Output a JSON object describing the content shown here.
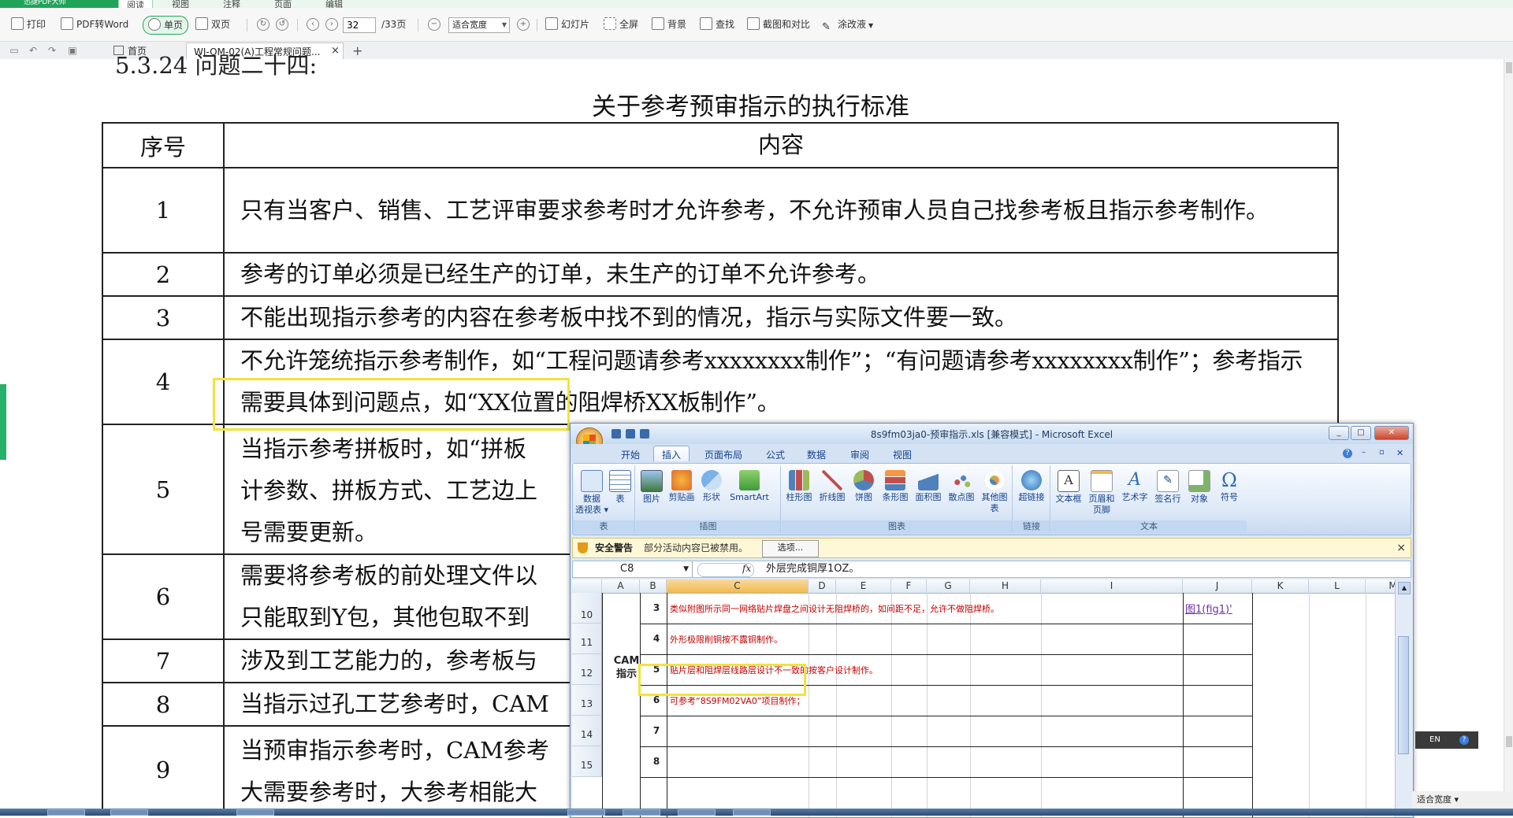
{
  "pdf_app": {
    "app_name": "迅捷PDF大师",
    "menu": [
      "阅读",
      "视图",
      "注释",
      "页面",
      "编辑"
    ],
    "toolbar": {
      "print": "打印",
      "pdf_to_word": "PDF转Word",
      "single_page": "单页",
      "double_page": "双页",
      "current_page": "32",
      "total_pages": "/33页",
      "zoom": "适合宽度",
      "slideshow": "幻灯片",
      "fullscreen": "全屏",
      "background": "背景",
      "find": "查找",
      "crop_compare": "截图和对比",
      "eraser": "涂改液"
    },
    "tabs": {
      "home": "首页",
      "document": "WI-OM-02(A)工程常规问题...",
      "close": "×",
      "add": "+"
    }
  },
  "document": {
    "section_heading": "5.3.24 问题二十四:",
    "title": "关于参考预审指示的执行标准",
    "table": {
      "headers": [
        "序号",
        "内容"
      ],
      "rows": [
        {
          "num": "1",
          "text": "只有当客户、销售、工艺评审要求参考时才允许参考，不允许预审人员自己找参考板且指示参考制作。"
        },
        {
          "num": "2",
          "text": "参考的订单必须是已经生产的订单，未生产的订单不允许参考。"
        },
        {
          "num": "3",
          "text": "不能出现指示参考的内容在参考板中找不到的情况，指示与实际文件要一致。"
        },
        {
          "num": "4",
          "text": "不允许笼统指示参考制作，如“工程问题请参考xxxxxxxx制作”；“有问题请参考xxxxxxxx制作”；参考指示需要具体到问题点，如“XX位置的阻焊桥XX板制作”。"
        },
        {
          "num": "5",
          "text": "当指示参考拼板时，如“拼板\n计参数、拼板方式、工艺边上\n号需要更新。"
        },
        {
          "num": "6",
          "text": "需要将参考板的前处理文件以\n只能取到Y包，其他包取不到"
        },
        {
          "num": "7",
          "text": "涉及到工艺能力的，参考板与"
        },
        {
          "num": "8",
          "text": "当指示过孔工艺参考时，CAM"
        },
        {
          "num": "9",
          "text": "当预审指示参考时，CAM参考\n大需要参考时，大参考相能大"
        }
      ]
    }
  },
  "excel": {
    "title": "8s9fm03ja0-预审指示.xls  [兼容模式] - Microsoft Excel",
    "tabs": [
      "开始",
      "插入",
      "页面布局",
      "公式",
      "数据",
      "审阅",
      "视图"
    ],
    "active_tab": "插入",
    "ribbon_groups": [
      {
        "label": "表",
        "buttons": [
          "数据\n透视表 ▾",
          "表"
        ]
      },
      {
        "label": "插图",
        "buttons": [
          "图片",
          "剪贴画",
          "形状",
          "SmartArt"
        ]
      },
      {
        "label": "图表",
        "buttons": [
          "柱形图",
          "折线图",
          "饼图",
          "条形图",
          "面积图",
          "散点图",
          "其他图表"
        ]
      },
      {
        "label": "链接",
        "buttons": [
          "超链接"
        ]
      },
      {
        "label": "文本",
        "buttons": [
          "文本框",
          "页眉和\n页脚",
          "艺术字",
          "签名行",
          "对象",
          "符号"
        ]
      }
    ],
    "security": {
      "title": "安全警告",
      "message": "部分活动内容已被禁用。",
      "button": "选项...",
      "close": "×"
    },
    "name_box": "C8",
    "fx": "fx",
    "formula": "外层完成铜厚1OZ。",
    "columns": [
      "A",
      "B",
      "C",
      "D",
      "E",
      "F",
      "G",
      "H",
      "I",
      "J",
      "K",
      "L",
      "M"
    ],
    "selected_column": "C",
    "row_numbers": [
      "10",
      "11",
      "12",
      "13",
      "14",
      "15"
    ],
    "group_label": "CAM\n指示",
    "rows": [
      {
        "b": "3",
        "c": "类似附图所示同一网络贴片焊盘之间设计无阻焊桥的，如间距不足，允许不做阻焊桥。",
        "j": "图1(fig1)'"
      },
      {
        "b": "4",
        "c": "外形极限削铜按不露铜制作。",
        "j": ""
      },
      {
        "b": "5",
        "c": "贴片层和阻焊层线路层设计不一致的按客户设计制作。",
        "j": ""
      },
      {
        "b": "6",
        "c": "可参考“8S9FM02VA0”项目制作；",
        "j": ""
      },
      {
        "b": "7",
        "c": "",
        "j": ""
      },
      {
        "b": "8",
        "c": "",
        "j": ""
      }
    ]
  },
  "status": {
    "ime": "EN",
    "zoom": "适合宽度 ▾"
  },
  "colors": {
    "brand_green": "#22a35a",
    "highlight": "#f0e43a",
    "excel_red": "#c00000"
  }
}
